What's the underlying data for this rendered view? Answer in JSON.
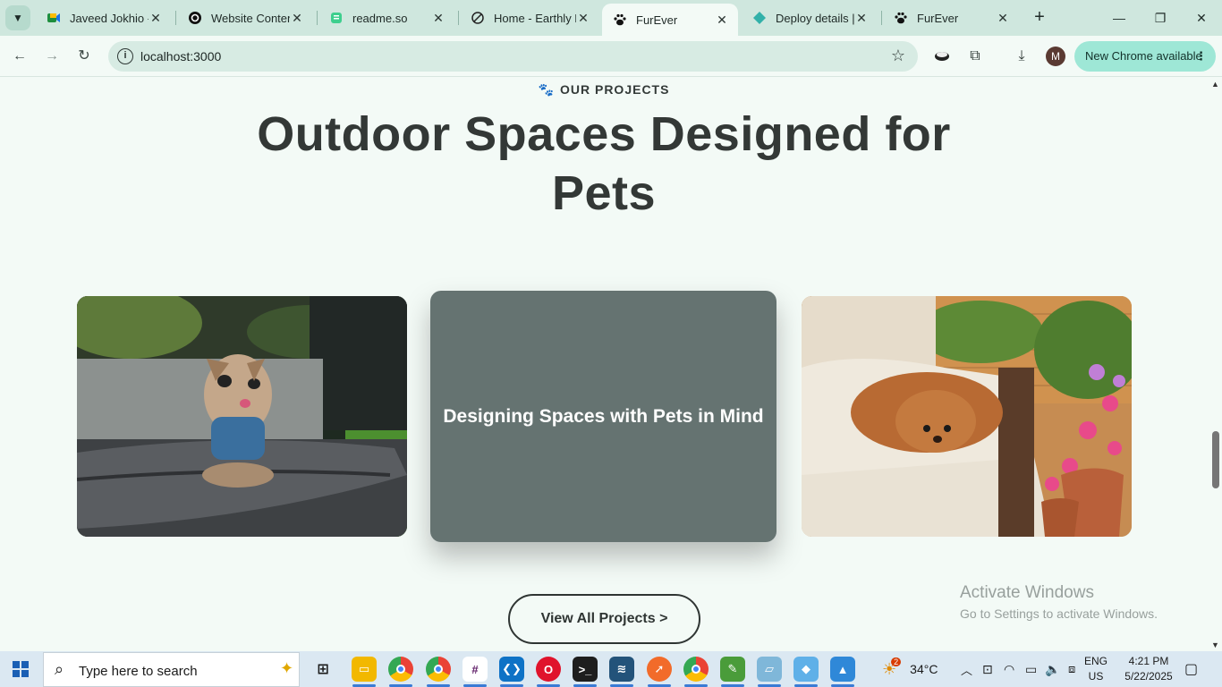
{
  "browser": {
    "tabs": [
      {
        "title": "Javeed Jokhio - (",
        "icon": "meet-icon",
        "active": false
      },
      {
        "title": "Website Content",
        "icon": "openai-icon",
        "active": false
      },
      {
        "title": "readme.so",
        "icon": "readme-icon",
        "active": false
      },
      {
        "title": "Home - Earthly D",
        "icon": "earthly-icon",
        "active": false
      },
      {
        "title": "FurEver",
        "icon": "paw-icon",
        "active": true
      },
      {
        "title": "Deploy details |",
        "icon": "netlify-icon",
        "active": false
      },
      {
        "title": "FurEver",
        "icon": "paw-icon",
        "active": false
      }
    ],
    "url": "localhost:3000",
    "profile_initial": "M",
    "update_label": "New Chrome available"
  },
  "page": {
    "eyebrow": "OUR PROJECTS",
    "heading": "Outdoor Spaces Designed for Pets",
    "cards": [
      {
        "type": "image",
        "alt": "yorkie on dog bed"
      },
      {
        "type": "caption",
        "caption": "Designing Spaces with Pets in Mind"
      },
      {
        "type": "image",
        "alt": "poodle on garden sofa"
      }
    ],
    "cta_label": "View All Projects >",
    "watermark_title": "Activate Windows",
    "watermark_sub": "Go to Settings to activate Windows."
  },
  "taskbar": {
    "search_placeholder": "Type here to search",
    "weather_temp": "34°C",
    "weather_badge": "2",
    "lang_line1": "ENG",
    "lang_line2": "US",
    "time": "4:21 PM",
    "date": "5/22/2025"
  },
  "colors": {
    "page_bg": "#f3faf6",
    "tabstrip_bg": "#cfe7de",
    "mid_card_bg": "#657371",
    "update_pill": "#9ee7d6"
  }
}
